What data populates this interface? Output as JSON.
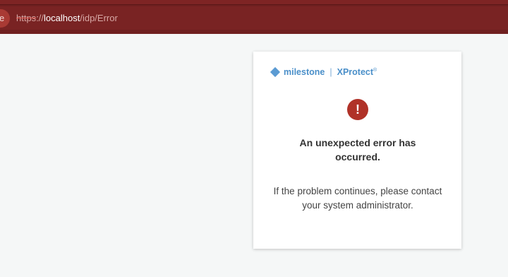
{
  "browser": {
    "security_label": "e",
    "url": {
      "scheme": "https",
      "separator": "://",
      "host": "localhost",
      "path": "/idp/Error"
    }
  },
  "card": {
    "brand": {
      "company": "milestone",
      "divider": "|",
      "product": "XProtect",
      "reg": "®"
    },
    "icon": {
      "name": "exclamation-circle-icon",
      "glyph": "!",
      "color": "#b03228"
    },
    "headline": "An unexpected error has occurred.",
    "message": "If the problem continues, please contact your system administrator."
  },
  "colors": {
    "browser_bar": "#6f2020",
    "brand": "#4a8fc9",
    "page_background": "#f5f7f7"
  }
}
